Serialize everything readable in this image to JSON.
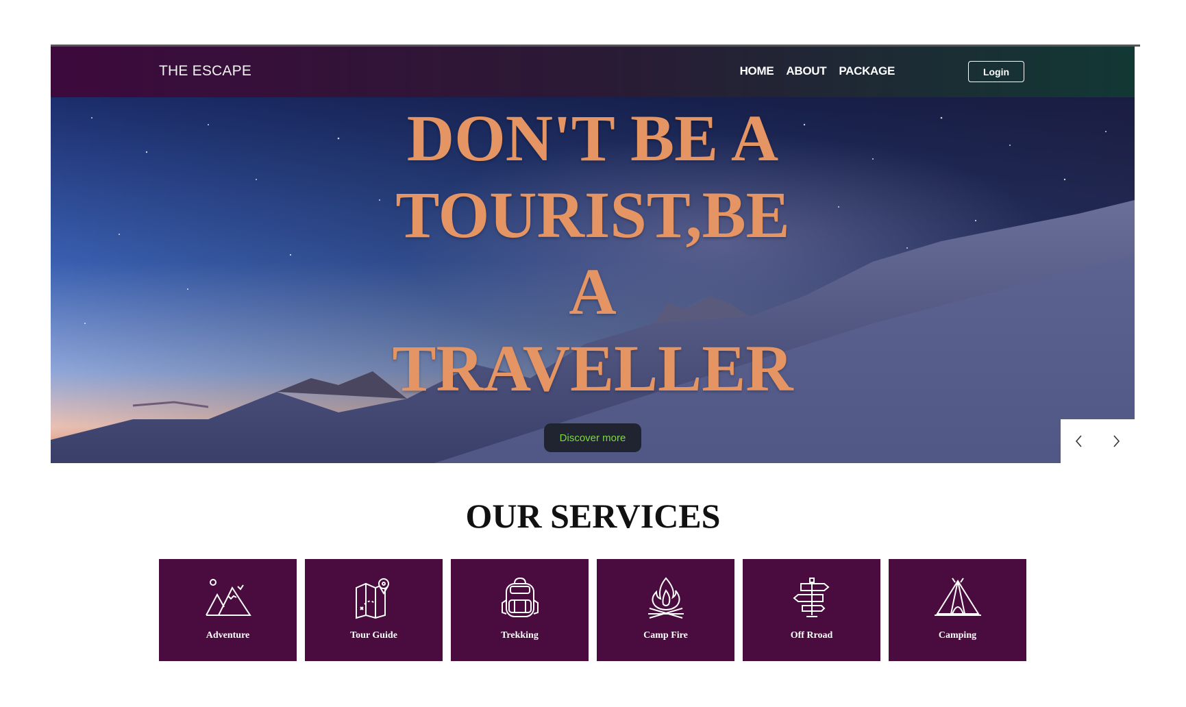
{
  "navbar": {
    "brand": "THE ESCAPE",
    "links": [
      "HOME",
      "ABOUT",
      "PACKAGE"
    ],
    "login_label": "Login"
  },
  "hero": {
    "headline_lines": [
      "DON'T BE A",
      "TOURIST,BE",
      "A",
      "TRAVELLER"
    ],
    "discover_label": "Discover more",
    "headline_color": "#e59463"
  },
  "services": {
    "title": "OUR SERVICES",
    "cards": [
      {
        "label": "Adventure",
        "icon": "mountain-icon"
      },
      {
        "label": "Tour Guide",
        "icon": "map-icon"
      },
      {
        "label": "Trekking",
        "icon": "backpack-icon"
      },
      {
        "label": "Camp Fire",
        "icon": "campfire-icon"
      },
      {
        "label": "Off Rroad",
        "icon": "signpost-icon"
      },
      {
        "label": "Camping",
        "icon": "tent-icon"
      }
    ],
    "card_color": "#4a0b3e"
  }
}
